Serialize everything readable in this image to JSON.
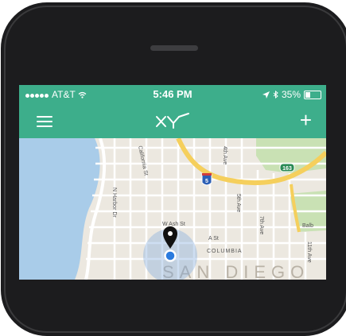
{
  "status_bar": {
    "carrier": "AT&T",
    "time": "5:46 PM",
    "battery": "35%",
    "wifi_icon": "wifi-icon",
    "location_icon": "location-arrow-icon",
    "bluetooth_icon": "bluetooth-icon"
  },
  "nav": {
    "menu_icon": "hamburger-menu-icon",
    "logo_icon": "xy-logo-icon",
    "add_label": "+"
  },
  "map": {
    "labels": {
      "street_california": "California St",
      "ave_4th": "4th Ave",
      "ave_5th": "5th Ave",
      "ave_7th": "7th Ave",
      "ave_11th": "11th Ave",
      "harbor_dr": "N Harbor Dr",
      "ash_st": "W Ash St",
      "a_st": "A St",
      "columbia": "COLUMBIA",
      "balboa": "Balb",
      "san_diego": "SAN DIEGO",
      "interstate_5": "5",
      "route_163": "163"
    },
    "colors": {
      "water": "#a9cce9",
      "land": "#ece8e0",
      "freeway": "#f5cf5c",
      "park": "#c9e1b4",
      "accent": "#3dae8b"
    }
  }
}
